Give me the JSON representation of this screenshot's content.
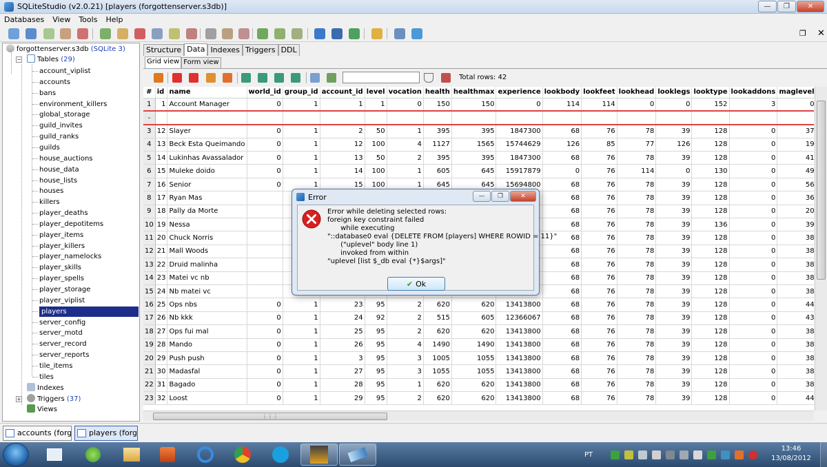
{
  "window": {
    "title": "SQLiteStudio (v2.0.21) [players (forgottenserver.s3db)]"
  },
  "menu": [
    "Databases",
    "View",
    "Tools",
    "Help"
  ],
  "tree": {
    "database": "forgottenserver.s3db",
    "database_type": "(SQLite 3)",
    "tables_label": "Tables",
    "tables_count": "(29)",
    "tables": [
      "account_viplist",
      "accounts",
      "bans",
      "environment_killers",
      "global_storage",
      "guild_invites",
      "guild_ranks",
      "guilds",
      "house_auctions",
      "house_data",
      "house_lists",
      "houses",
      "killers",
      "player_deaths",
      "player_depotitems",
      "player_items",
      "player_killers",
      "player_namelocks",
      "player_skills",
      "player_spells",
      "player_storage",
      "player_viplist",
      "players",
      "server_config",
      "server_motd",
      "server_record",
      "server_reports",
      "tile_items",
      "tiles"
    ],
    "selected_table": "players",
    "indexes_label": "Indexes",
    "triggers_label": "Triggers",
    "triggers_count": "(37)",
    "views_label": "Views"
  },
  "tabs": [
    "Structure",
    "Data",
    "Indexes",
    "Triggers",
    "DDL"
  ],
  "active_tab": "Data",
  "subtabs": [
    "Grid view",
    "Form view"
  ],
  "active_subtab": "Grid view",
  "filter": {
    "value": ""
  },
  "total_rows": "Total rows: 42",
  "grid": {
    "columns": [
      "#",
      "id",
      "name",
      "world_id",
      "group_id",
      "account_id",
      "level",
      "vocation",
      "health",
      "healthmax",
      "experience",
      "lookbody",
      "lookfeet",
      "lookhead",
      "looklegs",
      "looktype",
      "lookaddons",
      "maglevel",
      "m"
    ],
    "rows": [
      [
        "1",
        "1",
        "Account Manager",
        "0",
        "1",
        "1",
        "1",
        "0",
        "150",
        "150",
        "0",
        "114",
        "114",
        "0",
        "0",
        "152",
        "3",
        "0"
      ],
      [
        "-",
        "",
        "",
        "",
        "",
        "",
        "",
        "",
        "",
        "",
        "",
        "",
        "",
        "",
        "",
        "",
        "",
        ""
      ],
      [
        "3",
        "12",
        "Slayer",
        "0",
        "1",
        "2",
        "50",
        "1",
        "395",
        "395",
        "1847300",
        "68",
        "76",
        "78",
        "39",
        "128",
        "0",
        "37"
      ],
      [
        "4",
        "13",
        "Beck Esta Queimando",
        "0",
        "1",
        "12",
        "100",
        "4",
        "1127",
        "1565",
        "15744629",
        "126",
        "85",
        "77",
        "126",
        "128",
        "0",
        "19"
      ],
      [
        "5",
        "14",
        "Lukinhas Avassalador",
        "0",
        "1",
        "13",
        "50",
        "2",
        "395",
        "395",
        "1847300",
        "68",
        "76",
        "78",
        "39",
        "128",
        "0",
        "41"
      ],
      [
        "6",
        "15",
        "Muleke doido",
        "0",
        "1",
        "14",
        "100",
        "1",
        "605",
        "645",
        "15917879",
        "0",
        "76",
        "114",
        "0",
        "130",
        "0",
        "49"
      ],
      [
        "7",
        "16",
        "Senior",
        "0",
        "1",
        "15",
        "100",
        "1",
        "645",
        "645",
        "15694800",
        "68",
        "76",
        "78",
        "39",
        "128",
        "0",
        "56"
      ],
      [
        "8",
        "17",
        "Ryan Mas",
        "",
        "",
        "",
        "",
        "",
        "",
        "",
        "",
        "68",
        "76",
        "78",
        "39",
        "128",
        "0",
        "36"
      ],
      [
        "9",
        "18",
        "Pally da Morte",
        "",
        "",
        "",
        "",
        "",
        "",
        "",
        "",
        "68",
        "76",
        "78",
        "39",
        "128",
        "0",
        "20"
      ],
      [
        "10",
        "19",
        "Nessa",
        "",
        "",
        "",
        "",
        "",
        "",
        "",
        "",
        "68",
        "76",
        "78",
        "39",
        "136",
        "0",
        "39"
      ],
      [
        "11",
        "20",
        "Chuck Norris",
        "",
        "",
        "",
        "",
        "",
        "",
        "",
        "",
        "68",
        "76",
        "78",
        "39",
        "128",
        "0",
        "38"
      ],
      [
        "12",
        "21",
        "Mall Woods",
        "",
        "",
        "",
        "",
        "",
        "",
        "",
        "",
        "68",
        "76",
        "78",
        "39",
        "128",
        "0",
        "38"
      ],
      [
        "13",
        "22",
        "Druid malinha",
        "",
        "",
        "",
        "",
        "",
        "",
        "",
        "",
        "68",
        "76",
        "78",
        "39",
        "128",
        "0",
        "38"
      ],
      [
        "14",
        "23",
        "Matei vc nb",
        "",
        "",
        "",
        "",
        "",
        "",
        "",
        "",
        "68",
        "76",
        "78",
        "39",
        "128",
        "0",
        "38"
      ],
      [
        "15",
        "24",
        "Nb matei vc",
        "",
        "",
        "",
        "",
        "",
        "",
        "",
        "",
        "68",
        "76",
        "78",
        "39",
        "128",
        "0",
        "38"
      ],
      [
        "16",
        "25",
        "Ops nbs",
        "0",
        "1",
        "23",
        "95",
        "2",
        "620",
        "620",
        "13413800",
        "68",
        "76",
        "78",
        "39",
        "128",
        "0",
        "44"
      ],
      [
        "17",
        "26",
        "Nb kkk",
        "0",
        "1",
        "24",
        "92",
        "2",
        "515",
        "605",
        "12366067",
        "68",
        "76",
        "78",
        "39",
        "128",
        "0",
        "43"
      ],
      [
        "18",
        "27",
        "Ops fui mal",
        "0",
        "1",
        "25",
        "95",
        "2",
        "620",
        "620",
        "13413800",
        "68",
        "76",
        "78",
        "39",
        "128",
        "0",
        "38"
      ],
      [
        "19",
        "28",
        "Mando",
        "0",
        "1",
        "26",
        "95",
        "4",
        "1490",
        "1490",
        "13413800",
        "68",
        "76",
        "78",
        "39",
        "128",
        "0",
        "38"
      ],
      [
        "20",
        "29",
        "Push push",
        "0",
        "1",
        "3",
        "95",
        "3",
        "1005",
        "1055",
        "13413800",
        "68",
        "76",
        "78",
        "39",
        "128",
        "0",
        "38"
      ],
      [
        "21",
        "30",
        "Madasfal",
        "0",
        "1",
        "27",
        "95",
        "3",
        "1055",
        "1055",
        "13413800",
        "68",
        "76",
        "78",
        "39",
        "128",
        "0",
        "38"
      ],
      [
        "22",
        "31",
        "Bagado",
        "0",
        "1",
        "28",
        "95",
        "1",
        "620",
        "620",
        "13413800",
        "68",
        "76",
        "78",
        "39",
        "128",
        "0",
        "38"
      ],
      [
        "23",
        "32",
        "Loost",
        "0",
        "1",
        "29",
        "95",
        "2",
        "620",
        "620",
        "13413800",
        "68",
        "76",
        "78",
        "39",
        "128",
        "0",
        "44"
      ]
    ]
  },
  "window_tasks": [
    "accounts (forgot",
    "players (forgott"
  ],
  "dialog": {
    "title": "Error",
    "message": "Error while deleting selected rows:\nforeign key constraint failed\n      while executing\n\"::database0 eval {DELETE FROM [players] WHERE ROWID = 11}\"\n      (\"uplevel\" body line 1)\n      invoked from within\n\"uplevel [list $_db eval {*}$args]\"",
    "ok_label": "Ok"
  },
  "taskbar": {
    "lang": "PT",
    "time": "13:46",
    "date": "13/08/2012"
  },
  "colors": {
    "selection": "#1c2e8a",
    "new_row_border": "#e04040",
    "count_text": "#1c3fb5"
  }
}
